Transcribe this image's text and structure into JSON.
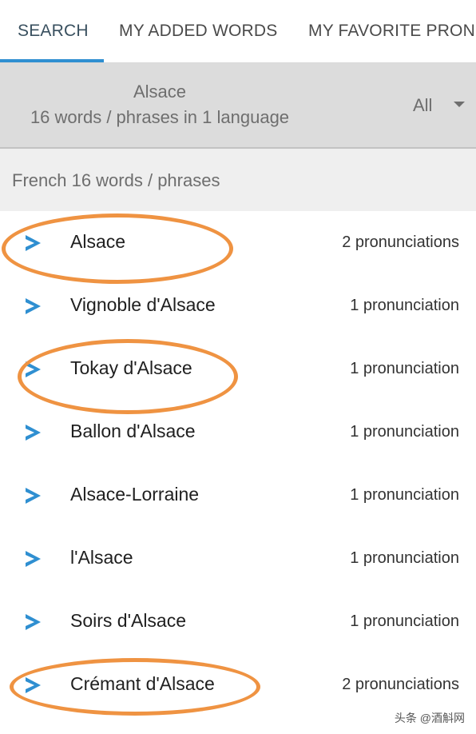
{
  "tabs": [
    {
      "label": "SEARCH",
      "active": true
    },
    {
      "label": "MY ADDED WORDS",
      "active": false
    },
    {
      "label": "MY FAVORITE PRON",
      "active": false
    }
  ],
  "summary": {
    "title": "Alsace",
    "count_text": "16 words / phrases in 1 language",
    "filter_value": "All"
  },
  "section": {
    "label": "French 16 words / phrases"
  },
  "rows": [
    {
      "word": "Alsace",
      "pronunciations": "2 pronunciations",
      "highlighted": true
    },
    {
      "word": "Vignoble d'Alsace",
      "pronunciations": "1 pronunciation",
      "highlighted": false
    },
    {
      "word": "Tokay d'Alsace",
      "pronunciations": "1 pronunciation",
      "highlighted": true
    },
    {
      "word": "Ballon d'Alsace",
      "pronunciations": "1 pronunciation",
      "highlighted": false
    },
    {
      "word": "Alsace-Lorraine",
      "pronunciations": "1 pronunciation",
      "highlighted": false
    },
    {
      "word": "l'Alsace",
      "pronunciations": "1 pronunciation",
      "highlighted": false
    },
    {
      "word": "Soirs d'Alsace",
      "pronunciations": "1 pronunciation",
      "highlighted": false
    },
    {
      "word": "Crémant d'Alsace",
      "pronunciations": "2 pronunciations",
      "highlighted": true
    }
  ],
  "watermark": "头条 @酒斛网",
  "colors": {
    "accent": "#2f8fd1",
    "play_icon": "#2f8fd1",
    "highlight_circle": "#ef9342",
    "summary_background": "#dcdcdc"
  }
}
